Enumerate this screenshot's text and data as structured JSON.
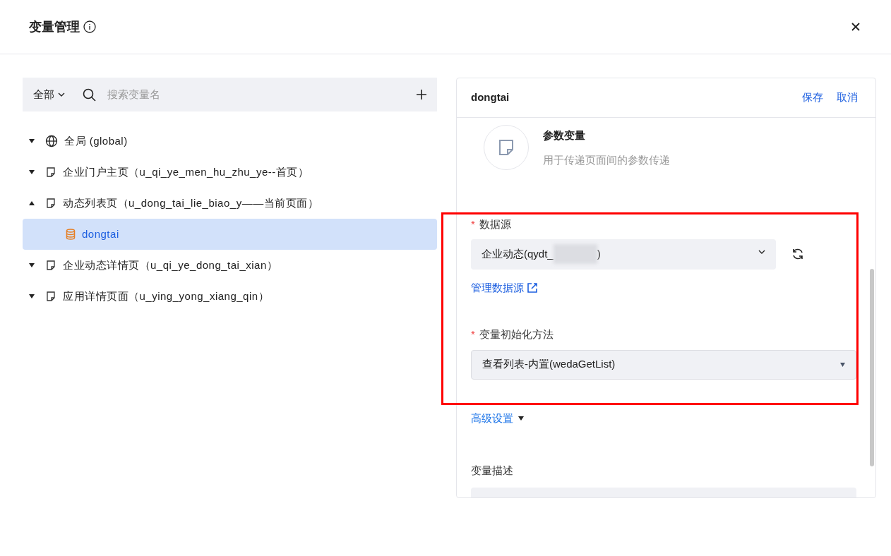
{
  "dialog": {
    "title": "变量管理"
  },
  "left": {
    "filter": "全部",
    "search": {
      "placeholder": "搜索变量名"
    },
    "tree": [
      {
        "label": "全局 (global)",
        "kind": "globe",
        "expanded": false,
        "selected": false
      },
      {
        "label": "企业门户主页（u_qi_ye_men_hu_zhu_ye--首页）",
        "kind": "page",
        "expanded": false,
        "selected": false
      },
      {
        "label": "动态列表页（u_dong_tai_lie_biao_y——当前页面）",
        "kind": "page",
        "expanded": true,
        "selected": false,
        "children": [
          {
            "label": "dongtai",
            "kind": "database",
            "selected": true
          }
        ]
      },
      {
        "label": "企业动态详情页（u_qi_ye_dong_tai_xian）",
        "kind": "page",
        "expanded": false,
        "selected": false
      },
      {
        "label": "应用详情页面（u_ying_yong_xiang_qin）",
        "kind": "page",
        "expanded": false,
        "selected": false
      }
    ]
  },
  "right": {
    "name": "dongtai",
    "actions": [
      "保存",
      "取消"
    ],
    "type": {
      "title": "参数变量",
      "description": "用于传递页面间的参数传递"
    },
    "datasource": {
      "label": "数据源",
      "required_mark": "*",
      "value_prefix": "企业动态(qydt_",
      "value_suffix": ")",
      "link": "管理数据源"
    },
    "init_method": {
      "label": "变量初始化方法",
      "required_mark": "*",
      "value": "查看列表-内置(wedaGetList)"
    },
    "advanced": "高级设置",
    "description": {
      "label": "变量描述"
    }
  }
}
